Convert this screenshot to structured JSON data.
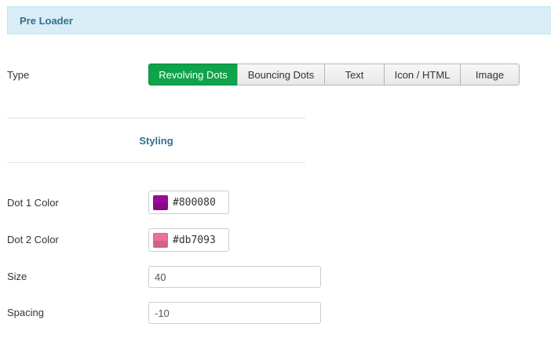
{
  "panel": {
    "title": "Pre Loader"
  },
  "type_field": {
    "label": "Type",
    "options": [
      "Revolving Dots",
      "Bouncing Dots",
      "Text",
      "Icon / HTML",
      "Image"
    ],
    "selected": "Revolving Dots"
  },
  "styling": {
    "section_title": "Styling",
    "dot1": {
      "label": "Dot 1 Color",
      "value": "#800080",
      "swatch": "#9a0a9a"
    },
    "dot2": {
      "label": "Dot 2 Color",
      "value": "#db7093",
      "swatch": "#ee6f9a"
    },
    "size": {
      "label": "Size",
      "value": "40"
    },
    "spacing": {
      "label": "Spacing",
      "value": "-10"
    }
  },
  "colors": {
    "active_button": "#0fa34b",
    "header_bg": "#d9edf7",
    "header_text": "#31708f"
  }
}
